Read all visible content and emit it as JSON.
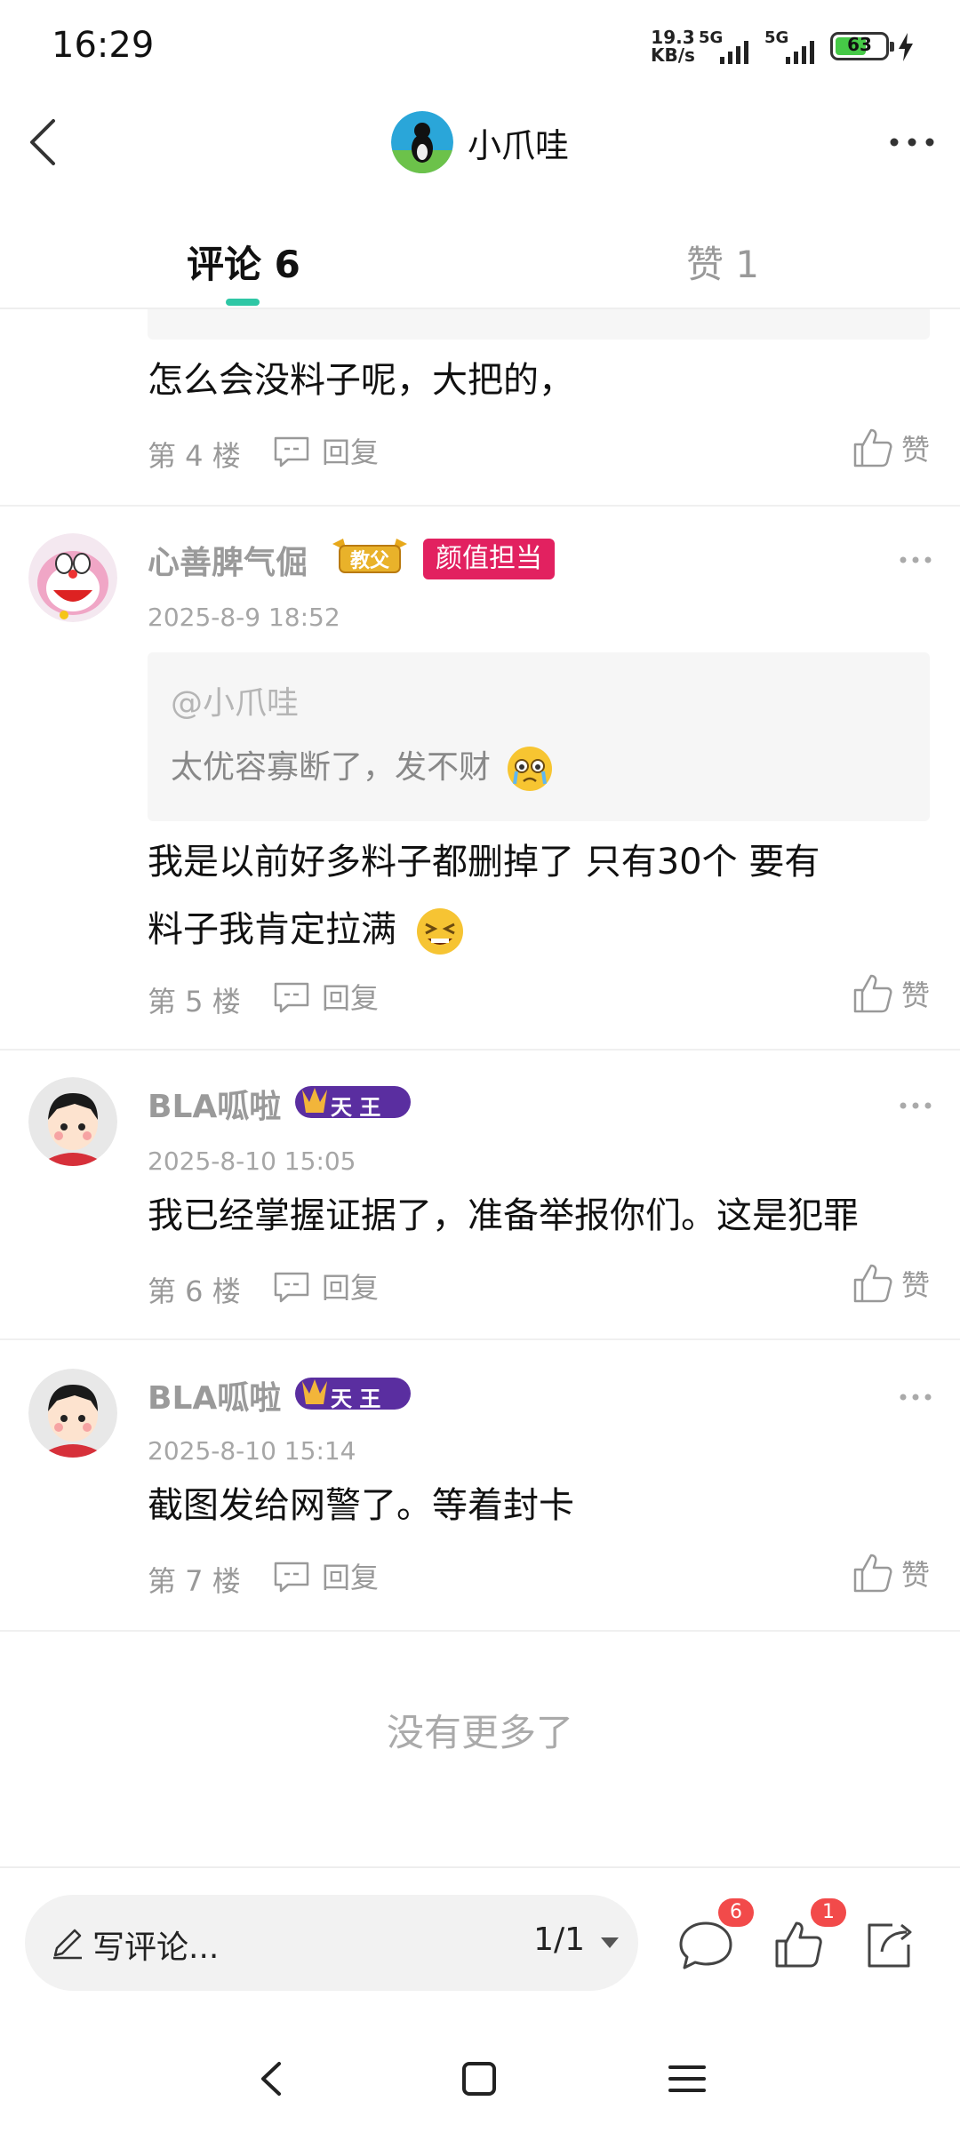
{
  "status": {
    "time": "16:29",
    "net_speed_value": "19.3",
    "net_speed_unit": "KB/s",
    "signal1_label": "5G",
    "signal2_label": "5G",
    "battery": "63",
    "battery_level": 0.63
  },
  "header": {
    "title": "小爪哇",
    "icons": {
      "back": "chevron-left-icon",
      "more": "more-horizontal-icon"
    }
  },
  "tabs": {
    "comments": "评论 6",
    "likes": "赞 1",
    "accent": "#2ec7a5"
  },
  "comments": [
    {
      "text": "怎么会没料子呢，大把的，",
      "floor": "第 4 楼",
      "reply": "回复",
      "like": "赞"
    },
    {
      "username": "心善脾气倔",
      "badge_title": "教父",
      "badge_label": "颜值担当",
      "date": "2025-8-9 18:52",
      "quote_at": "@小爪哇",
      "quote_text": "太优容寡断了，发不财",
      "text_line1": "我是以前好多料子都删掉了  只有30个 要有",
      "text_line2": "料子我肯定拉满",
      "floor": "第 5 楼",
      "reply": "回复",
      "like": "赞"
    },
    {
      "username": "BLA呱啦",
      "badge_title": "天 王",
      "date": "2025-8-10 15:05",
      "text": "我已经掌握证据了，准备举报你们。这是犯罪",
      "floor": "第 6 楼",
      "reply": "回复",
      "like": "赞"
    },
    {
      "username": "BLA呱啦",
      "badge_title": "天 王",
      "date": "2025-8-10 15:14",
      "text": "截图发给网警了。等着封卡",
      "floor": "第 7 楼",
      "reply": "回复",
      "like": "赞"
    }
  ],
  "footer_text": "没有更多了",
  "bottom": {
    "placeholder": "写评论...",
    "page": "1/1",
    "comment_count": "6",
    "like_count": "1"
  },
  "colors": {
    "badge_red": "#e22160",
    "count_badge": "#f24a4a"
  }
}
